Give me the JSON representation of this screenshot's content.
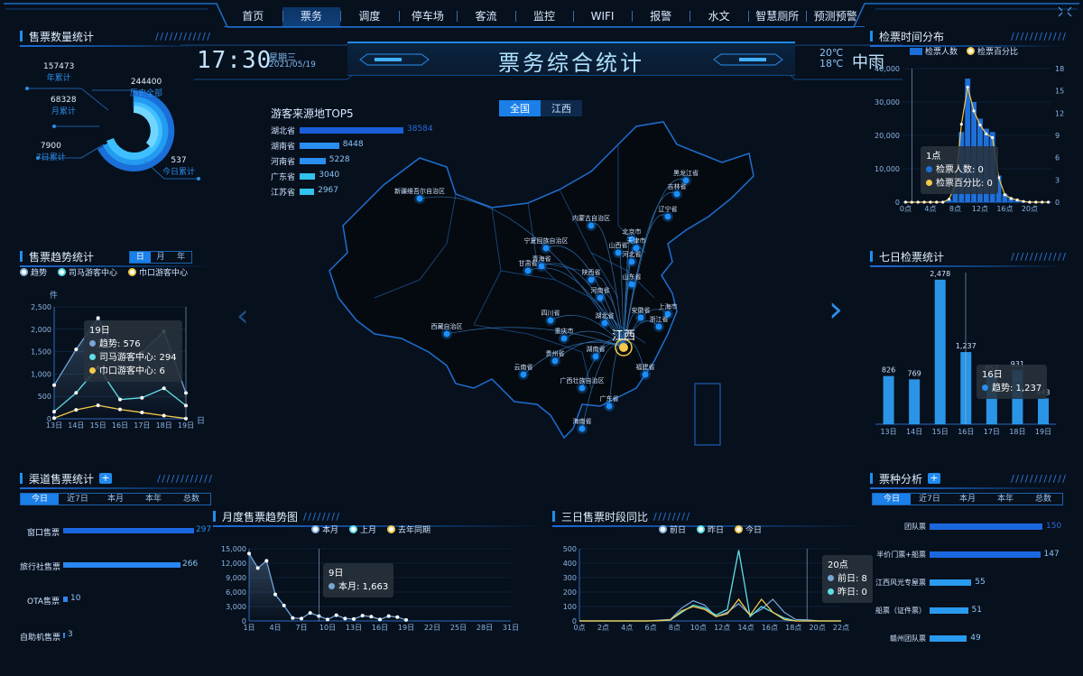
{
  "nav": {
    "items": [
      "首页",
      "票务",
      "调度",
      "停车场",
      "客流",
      "监控",
      "WIFI",
      "报警",
      "水文",
      "智慧厕所",
      "预测预警"
    ],
    "active": 1
  },
  "header": {
    "time": "17:30",
    "weekday": "星期三",
    "date": "2021/05/19",
    "title": "票务综合统计",
    "temp_high": "20℃",
    "temp_low": "18℃",
    "weather": "中雨"
  },
  "colors": {
    "accent": "#1a7fe8",
    "yellow": "#f5c94a",
    "cyan": "#5fe0e6",
    "bg": "#07101d"
  },
  "sales_count": {
    "title": "售票数量统计",
    "items": [
      {
        "value": "157473",
        "label": "年累计"
      },
      {
        "value": "244400",
        "label": "历史全部"
      },
      {
        "value": "68328",
        "label": "月累计"
      },
      {
        "value": "7900",
        "label": "7日累计"
      },
      {
        "value": "537",
        "label": "今日累计"
      }
    ]
  },
  "sales_trend": {
    "title": "售票趋势统计",
    "tabs": [
      "日",
      "月",
      "年"
    ],
    "legend": [
      "趋势",
      "司马游客中心",
      "巾口游客中心"
    ],
    "unit": "件",
    "day_suffix": "日",
    "tooltip": {
      "title": "19日",
      "rows": [
        "趋势: 576",
        "司马游客中心: 294",
        "巾口游客中心: 6"
      ]
    }
  },
  "channel": {
    "title": "渠道售票统计",
    "tabs": [
      "今日",
      "近7日",
      "本月",
      "本年",
      "总数"
    ],
    "items": [
      {
        "label": "窗口售票",
        "value": "297"
      },
      {
        "label": "旅行社售票",
        "value": "266"
      },
      {
        "label": "OTA售票",
        "value": "10"
      },
      {
        "label": "自助机售票",
        "value": "3"
      }
    ]
  },
  "map": {
    "top5_title": "游客来源地TOP5",
    "top5": [
      {
        "name": "湖北省",
        "value": "38584",
        "pct": 1.0
      },
      {
        "name": "湖南省",
        "value": "8448",
        "pct": 0.38
      },
      {
        "name": "河南省",
        "value": "5228",
        "pct": 0.25
      },
      {
        "name": "广东省",
        "value": "3040",
        "pct": 0.15
      },
      {
        "name": "江苏省",
        "value": "2967",
        "pct": 0.14
      }
    ],
    "toggle": [
      "全国",
      "江西"
    ],
    "center": "江西",
    "labels": [
      "新疆维吾尔自治区",
      "内蒙古自治区",
      "黑龙江省",
      "吉林省",
      "辽宁省",
      "北京市",
      "天津市",
      "宁夏回族自治区",
      "青海省",
      "甘肃省",
      "山西省",
      "河北省",
      "陕西省",
      "河南省",
      "山东省",
      "西藏自治区",
      "四川省",
      "湖北省",
      "安徽省",
      "上海市",
      "浙江省",
      "重庆市",
      "湖南省",
      "贵州省",
      "福建省",
      "云南省",
      "广西壮族自治区",
      "广东省",
      "海南省"
    ]
  },
  "check_time": {
    "title": "检票时间分布",
    "legend": [
      "检票人数",
      "检票百分比"
    ],
    "tooltip": {
      "title": "1点",
      "rows": [
        "检票人数: 0",
        "检票百分比: 0"
      ]
    }
  },
  "seven_day": {
    "title": "七日检票统计",
    "tooltip": {
      "title": "16日",
      "rows": [
        "趋势: 1,237"
      ]
    }
  },
  "ticket_type": {
    "title": "票种分析",
    "tabs": [
      "今日",
      "近7日",
      "本月",
      "本年",
      "总数"
    ],
    "items": [
      {
        "label": "团队票",
        "value": "150",
        "pct": 1.0
      },
      {
        "label": "半价门票+船票",
        "value": "147",
        "pct": 0.98
      },
      {
        "label": "江西风光专屋票",
        "value": "55",
        "pct": 0.37
      },
      {
        "label": "船票（证件票）",
        "value": "51",
        "pct": 0.34
      },
      {
        "label": "赣州团队票",
        "value": "49",
        "pct": 0.33
      }
    ]
  },
  "monthly": {
    "title": "月度售票趋势图",
    "legend": [
      "本月",
      "上月",
      "去年同期"
    ],
    "tooltip": {
      "title": "9日",
      "rows": [
        "本月: 1,663"
      ]
    }
  },
  "three_day": {
    "title": "三日售票时段同比",
    "legend": [
      "前日",
      "昨日",
      "今日"
    ],
    "tooltip": {
      "title": "20点",
      "rows": [
        "前日: 8",
        "昨日: 0"
      ]
    }
  },
  "chart_data": [
    {
      "type": "line",
      "title": "售票趋势统计",
      "ylabel": "件",
      "x": [
        "13日",
        "14日",
        "15日",
        "16日",
        "17日",
        "18日",
        "19日"
      ],
      "ylim": [
        0,
        2500
      ],
      "yticks": [
        0,
        500,
        1000,
        1500,
        2000,
        2500
      ],
      "series": [
        {
          "name": "趋势",
          "values": [
            750,
            1550,
            2250,
            1350,
            1480,
            1950,
            576
          ]
        },
        {
          "name": "司马游客中心",
          "values": [
            160,
            580,
            1150,
            430,
            470,
            680,
            294
          ]
        },
        {
          "name": "巾口游客中心",
          "values": [
            15,
            200,
            300,
            210,
            140,
            70,
            6
          ]
        }
      ]
    },
    {
      "type": "bar",
      "title": "检票时间分布",
      "x": [
        "0点",
        "1点",
        "2点",
        "3点",
        "4点",
        "5点",
        "6点",
        "7点",
        "8点",
        "9点",
        "10点",
        "11点",
        "12点",
        "13点",
        "14点",
        "15点",
        "16点",
        "17点",
        "18点",
        "19点",
        "20点",
        "21点",
        "22点",
        "23点"
      ],
      "xticks": [
        "0点",
        "4点",
        "8点",
        "12点",
        "16点",
        "20点"
      ],
      "ylim": [
        0,
        40000
      ],
      "yticks": [
        0,
        10000,
        20000,
        30000,
        40000
      ],
      "y2lim": [
        0,
        18
      ],
      "y2ticks": [
        0,
        3,
        6,
        9,
        12,
        15,
        18
      ],
      "series": [
        {
          "name": "检票人数",
          "values": [
            0,
            0,
            0,
            0,
            0,
            0,
            0,
            800,
            4500,
            21000,
            37000,
            30000,
            25000,
            22000,
            21000,
            8000,
            2500,
            1200,
            600,
            200,
            0,
            0,
            0,
            0
          ]
        },
        {
          "name": "检票百分比",
          "values": [
            0,
            0,
            0,
            0,
            0,
            0,
            0,
            0.4,
            2.2,
            10.5,
            15.5,
            12.3,
            10.4,
            9.2,
            8.7,
            3.3,
            1,
            0.5,
            0.3,
            0.1,
            0,
            0,
            0,
            0
          ]
        }
      ]
    },
    {
      "type": "bar",
      "title": "七日检票统计",
      "categories": [
        "13日",
        "14日",
        "15日",
        "16日",
        "17日",
        "18日",
        "19日"
      ],
      "values": [
        826,
        769,
        2478,
        1237,
        857,
        931,
        443
      ],
      "ylim": [
        0,
        2600
      ]
    },
    {
      "type": "line",
      "title": "月度售票趋势图",
      "x": [
        "1日",
        "3日",
        "5日",
        "7日",
        "9日",
        "11日",
        "13日",
        "15日",
        "17日",
        "19日",
        "21日",
        "23日",
        "25日",
        "27日",
        "29日",
        "31日"
      ],
      "xticks": [
        "1日",
        "4日",
        "7日",
        "10日",
        "13日",
        "16日",
        "19日",
        "22日",
        "25日",
        "28日",
        "31日"
      ],
      "ylim": [
        0,
        15000
      ],
      "yticks": [
        0,
        3000,
        6000,
        9000,
        12000,
        15000
      ],
      "series": [
        {
          "name": "本月",
          "values": [
            14000,
            11000,
            12500,
            5500,
            3200,
            600,
            500,
            1663,
            1000,
            300,
            1200,
            500,
            400,
            1100,
            900,
            300,
            1000,
            800,
            200
          ]
        },
        {
          "name": "上月",
          "values": []
        },
        {
          "name": "去年同期",
          "values": []
        }
      ]
    },
    {
      "type": "line",
      "title": "三日售票时段同比",
      "x": [
        "0点",
        "2点",
        "4点",
        "6点",
        "8点",
        "10点",
        "12点",
        "14点",
        "16点",
        "18点",
        "20点",
        "22点"
      ],
      "ylim": [
        0,
        500
      ],
      "yticks": [
        0,
        100,
        200,
        300,
        400,
        500
      ],
      "series": [
        {
          "name": "前日",
          "values": [
            0,
            0,
            0,
            0,
            0,
            0,
            0,
            5,
            10,
            90,
            140,
            110,
            30,
            60,
            120,
            40,
            80,
            150,
            60,
            10,
            8,
            0,
            0,
            0
          ]
        },
        {
          "name": "昨日",
          "values": [
            0,
            0,
            0,
            0,
            0,
            0,
            0,
            3,
            8,
            60,
            110,
            90,
            40,
            80,
            490,
            30,
            100,
            60,
            20,
            0,
            0,
            0,
            0,
            0
          ]
        },
        {
          "name": "今日",
          "values": [
            0,
            0,
            0,
            0,
            0,
            0,
            0,
            2,
            6,
            70,
            100,
            80,
            30,
            50,
            150,
            40,
            150,
            60,
            10,
            0,
            0,
            0,
            0,
            0
          ]
        }
      ]
    }
  ]
}
